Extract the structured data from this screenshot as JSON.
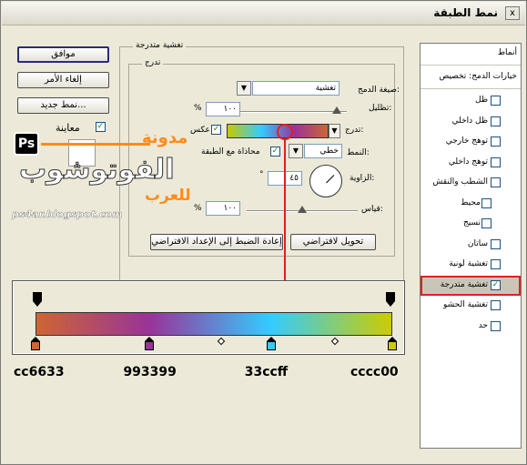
{
  "window": {
    "title": "نمط الطبقة",
    "close_glyph": "x"
  },
  "buttons": {
    "ok": "موافق",
    "cancel": "إلغاء الأمر",
    "new_style": "نمط جديد...",
    "preview": "معاينة",
    "make_default": "تحويل لافتراضي",
    "reset_default": "إعادة الضبط إلى الإعداد الافتراضي"
  },
  "gradient_overlay": {
    "group_title": "تغشية متدرجة",
    "subgroup_title": "تدرج",
    "blend_mode_label": "صيغة الدمج:",
    "blend_mode_value": "تغشية",
    "opacity_label": "تظليل:",
    "opacity_value": "١٠٠",
    "opacity_unit": "%",
    "gradient_label": "تدرج:",
    "reverse_label": "عكس",
    "style_label": "النمط:",
    "style_value": "خطي",
    "align_label": "محاذاة مع الطبقة",
    "angle_label": "الزاوية:",
    "angle_value": "٤٥",
    "angle_unit": "°",
    "scale_label": "قياس:",
    "scale_value": "١٠٠",
    "scale_unit": "%",
    "reverse_checked": true,
    "align_checked": true,
    "preview_checked": true
  },
  "styles_list": {
    "header": "أنماط",
    "blend_options": "خيارات الدمج: تخصيص",
    "items": [
      {
        "label": "ظل",
        "checked": false
      },
      {
        "label": "ظل داخلي",
        "checked": false
      },
      {
        "label": "توهج خارجي",
        "checked": false
      },
      {
        "label": "توهج داخلي",
        "checked": false
      },
      {
        "label": "الشطب والنقش",
        "checked": false
      },
      {
        "label": "محيط",
        "checked": false
      },
      {
        "label": "نسيج",
        "checked": false
      },
      {
        "label": "ساتان",
        "checked": false
      },
      {
        "label": "تغشية لونية",
        "checked": false
      },
      {
        "label": "تغشية متدرجة",
        "checked": true
      },
      {
        "label": "تغشية الحشو",
        "checked": false
      },
      {
        "label": "حد",
        "checked": false
      }
    ]
  },
  "gradient_stops": [
    {
      "hex": "cc6633",
      "color": "#cc6633",
      "position": 0.0
    },
    {
      "hex": "993399",
      "color": "#993399",
      "position": 0.32
    },
    {
      "hex": "33ccff",
      "color": "#33ccff",
      "position": 0.66
    },
    {
      "hex": "cccc00",
      "color": "#cccc00",
      "position": 1.0
    }
  ],
  "midpoint_positions": [
    0.52,
    0.84
  ],
  "colors": {
    "highlight_red": "#e02020",
    "selected_item_bg": "#c9c6b8"
  },
  "watermark": {
    "ps_badge": "Ps",
    "blog_word": "مدونة",
    "main_word": "الفوتوشوب",
    "arab_word": "للعرب",
    "url": "ps4ar.blogspot.com"
  }
}
